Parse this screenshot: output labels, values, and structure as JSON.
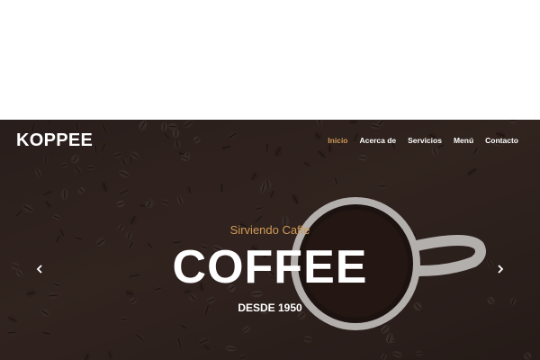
{
  "site": {
    "brand": "KOPPEE"
  },
  "nav": {
    "items": [
      {
        "label": "Inicio",
        "active": true
      },
      {
        "label": "Acerca de",
        "active": false
      },
      {
        "label": "Servicios",
        "active": false
      },
      {
        "label": "Menú",
        "active": false
      },
      {
        "label": "Contacto",
        "active": false
      }
    ]
  },
  "hero": {
    "kicker": "Sirviendo Caffe",
    "title": "COFFEE",
    "subtitle": "DESDE 1950",
    "prev_icon": "chevron-left-icon",
    "next_icon": "chevron-right-icon"
  },
  "colors": {
    "accent": "#d09b58",
    "hero_bg": "#2f2420",
    "text": "#ffffff"
  }
}
